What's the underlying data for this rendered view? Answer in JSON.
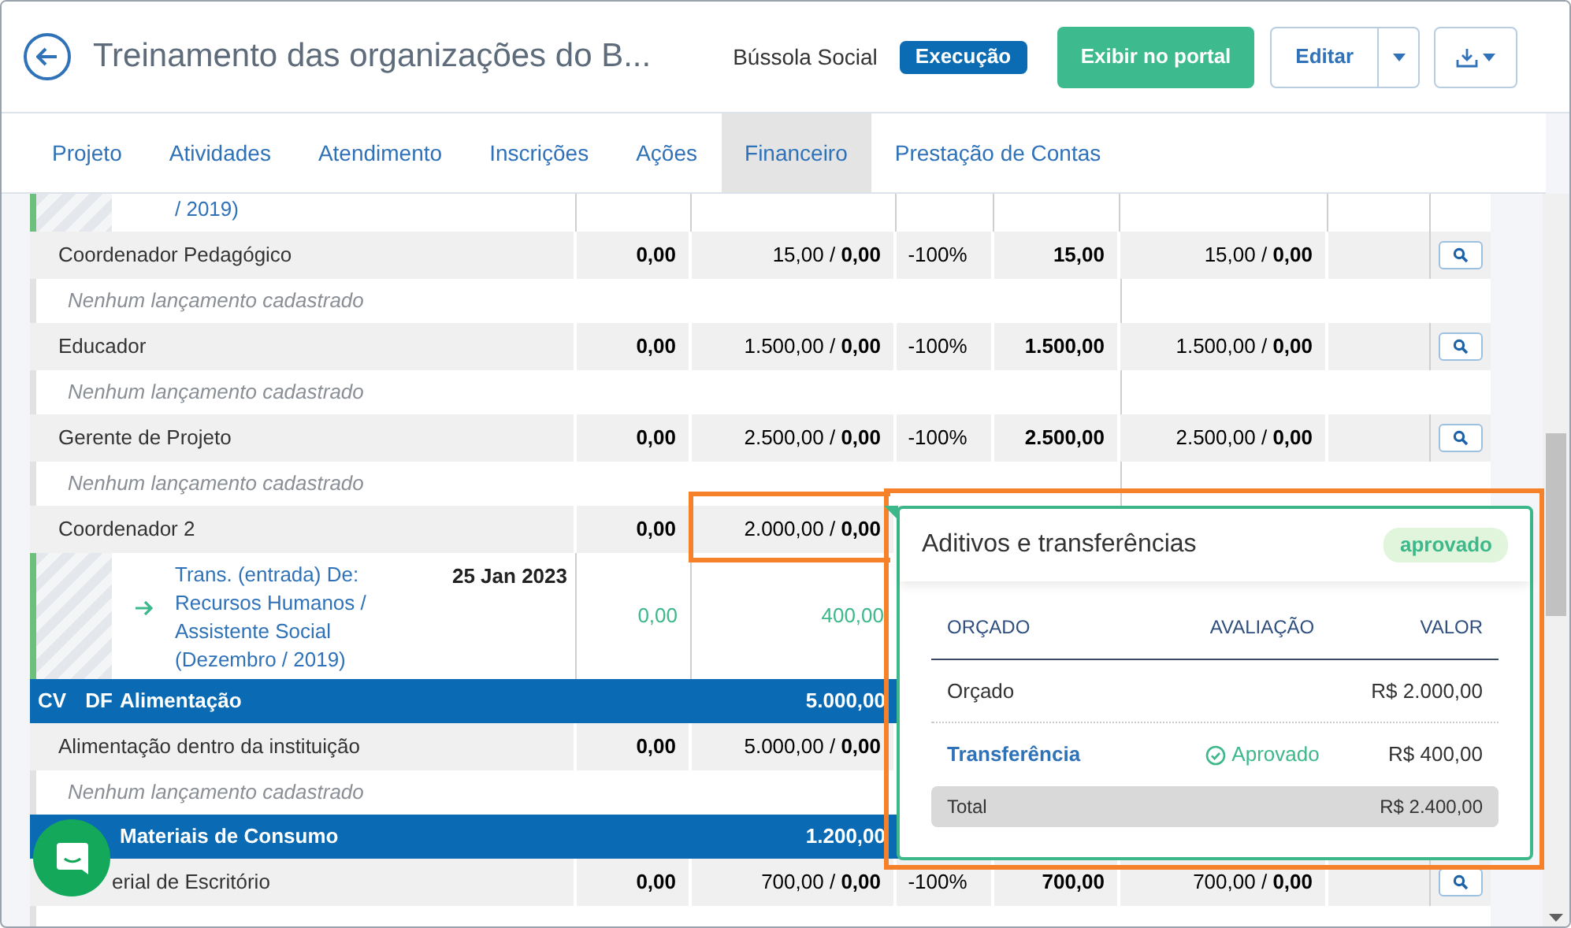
{
  "header": {
    "title": "Treinamento das organizações do B...",
    "organization": "Bússola Social",
    "status": "Execução",
    "portal_button": "Exibir no portal",
    "edit_button": "Editar"
  },
  "tabs": [
    {
      "label": "Projeto",
      "selected": false
    },
    {
      "label": "Atividades",
      "selected": false
    },
    {
      "label": "Atendimento",
      "selected": false
    },
    {
      "label": "Inscrições",
      "selected": false
    },
    {
      "label": "Ações",
      "selected": false
    },
    {
      "label": "Financeiro",
      "selected": true
    },
    {
      "label": "Prestação de Contas",
      "selected": false
    }
  ],
  "rows": [
    {
      "kind": "continuation",
      "text": "/ 2019)"
    },
    {
      "kind": "item",
      "label": "Coordenador Pedagógico",
      "planned": "0,00",
      "budget": "15,00 / **0,00**",
      "variation": "-100%",
      "total": "15,00",
      "balance": "15,00 / **0,00**",
      "search_button": true,
      "partly_hidden": false
    },
    {
      "kind": "empty",
      "text": "Nenhum lançamento cadastrado"
    },
    {
      "kind": "item",
      "label": "Educador",
      "planned": "0,00",
      "budget": "1.500,00 / **0,00**",
      "variation": "-100%",
      "total": "1.500,00",
      "balance": "1.500,00 / **0,00**",
      "search_button": true,
      "partly_hidden": false
    },
    {
      "kind": "empty",
      "text": "Nenhum lançamento cadastrado"
    },
    {
      "kind": "item",
      "label": "Gerente de Projeto",
      "planned": "0,00",
      "budget": "2.500,00 / **0,00**",
      "variation": "-100%",
      "total": "2.500,00",
      "balance": "2.500,00 / **0,00**",
      "search_button": true,
      "partly_hidden": false
    },
    {
      "kind": "empty",
      "text": "Nenhum lançamento cadastrado"
    },
    {
      "kind": "item",
      "label": "Coordenador 2",
      "planned": "0,00",
      "budget": "2.000,00 / **0,00**",
      "partly_hidden": false
    },
    {
      "kind": "transfer",
      "text": "Trans. (entrada) De: Recursos Humanos / Assistente Social (Dezembro / 2019)",
      "date": "25 Jan 2023",
      "planned": "0,00",
      "budget": "400,00"
    },
    {
      "kind": "category",
      "codes": [
        "CV",
        "DF"
      ],
      "label": "Alimentação",
      "total": "5.000,00"
    },
    {
      "kind": "item",
      "label": "Alimentação dentro da instituição",
      "planned": "0,00",
      "budget": "5.000,00 / **0,00**",
      "partly_hidden": false
    },
    {
      "kind": "empty",
      "text": "Nenhum lançamento cadastrado"
    },
    {
      "kind": "category",
      "codes": [],
      "label": "Materiais de Consumo",
      "total": "1.200,00"
    },
    {
      "kind": "item",
      "label": "erial de Escritório",
      "planned": "0,00",
      "budget": "700,00 / **0,00**",
      "variation": "-100%",
      "total": "700,00",
      "balance": "700,00 / **0,00**",
      "search_button": true,
      "partly_hidden": true
    }
  ],
  "popover": {
    "title": "Aditivos e transferências",
    "status": "aprovado",
    "columns": [
      "ORÇADO",
      "AVALIAÇÃO",
      "VALOR"
    ],
    "rows": [
      {
        "kind": "plain",
        "name": "Orçado",
        "value": "R$ 2.000,00"
      },
      {
        "kind": "link",
        "name": "Transferência",
        "evaluation": "Aprovado",
        "value": "R$ 400,00"
      }
    ],
    "total": {
      "label": "Total",
      "value": "R$ 2.400,00"
    }
  }
}
